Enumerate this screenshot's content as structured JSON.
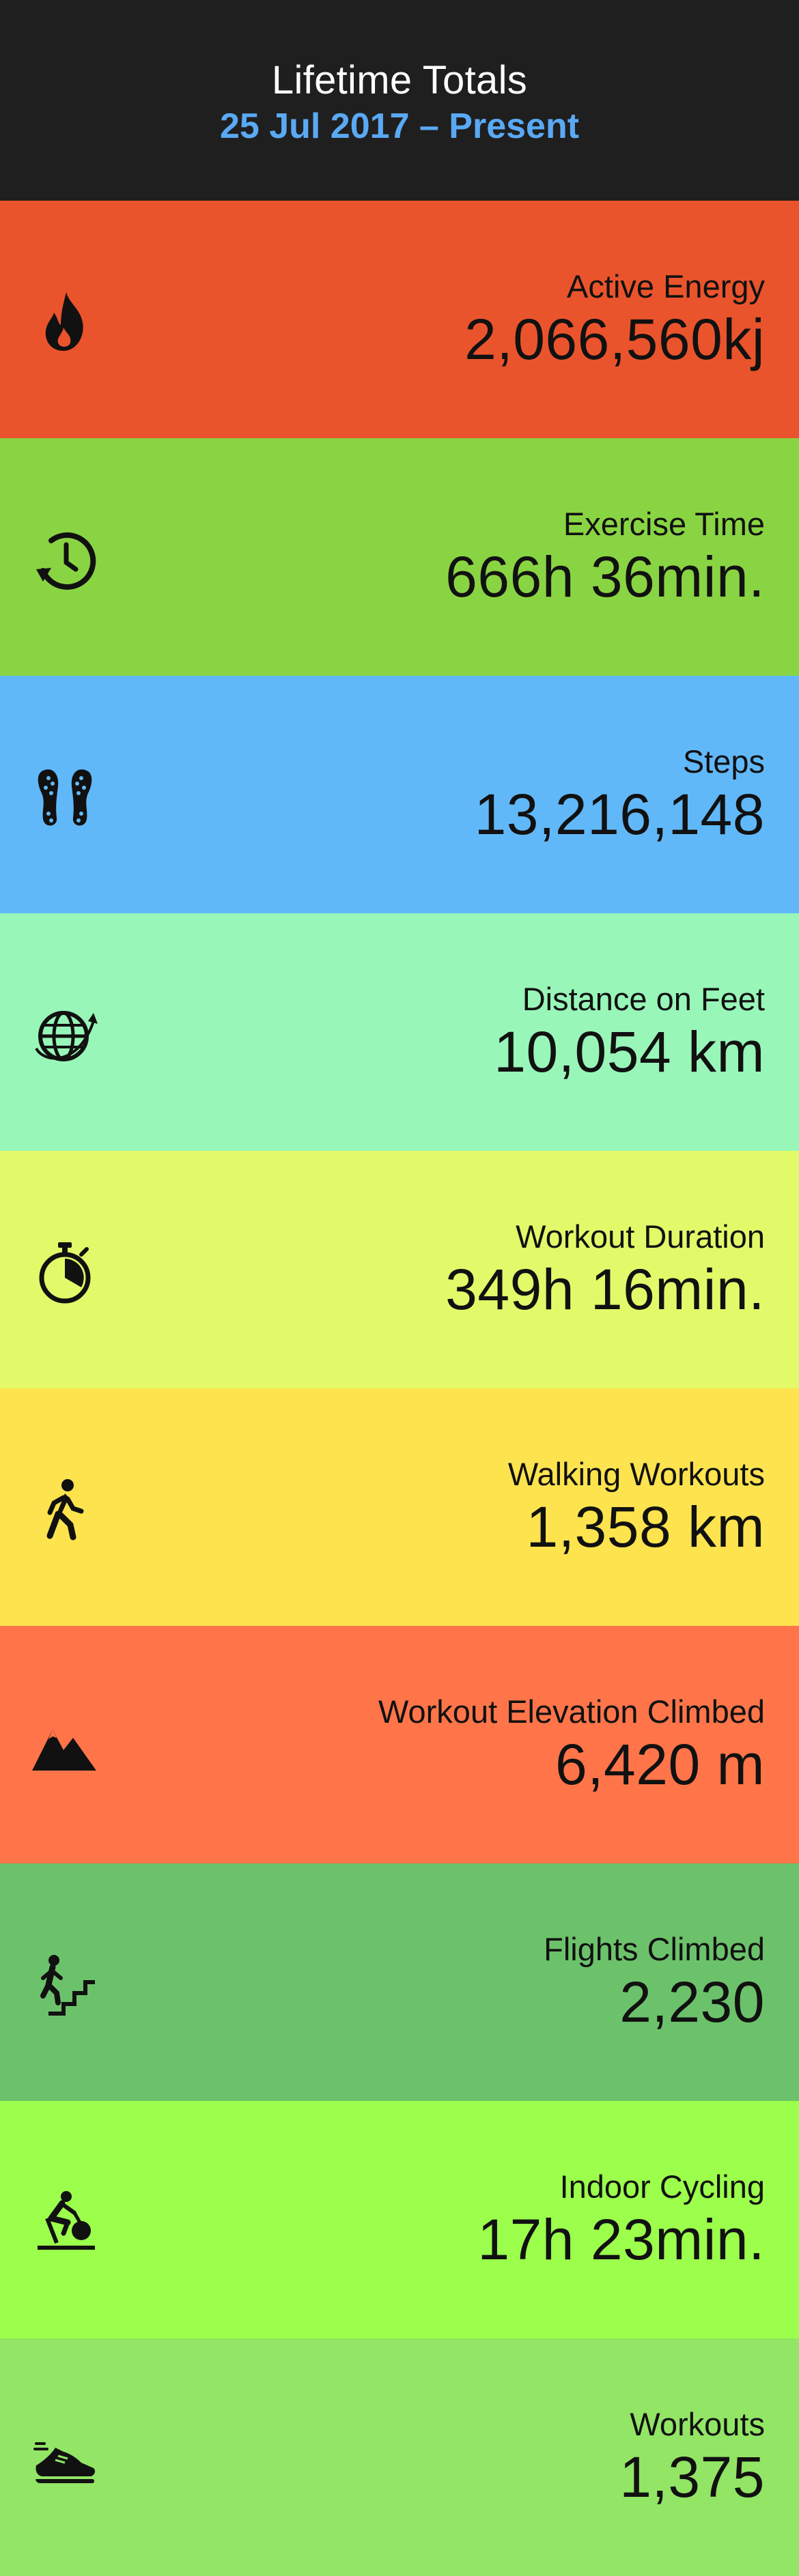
{
  "header": {
    "title": "Lifetime Totals",
    "subtitle": "25 Jul 2017 – Present",
    "subtitle_color": "#5aa9f4"
  },
  "rows": [
    {
      "label": "Active Energy",
      "value": "2,066,560kj",
      "color": "#ea542c",
      "icon": "flame-icon"
    },
    {
      "label": "Exercise Time",
      "value": "666h 36min.",
      "color": "#89d443",
      "icon": "clock-arrow-icon"
    },
    {
      "label": "Steps",
      "value": "13,216,148",
      "color": "#61b8f8",
      "icon": "footprints-icon"
    },
    {
      "label": "Distance on Feet",
      "value": "10,054 km",
      "color": "#98f6b8",
      "icon": "globe-icon"
    },
    {
      "label": "Workout Duration",
      "value": "349h 16min.",
      "color": "#e2fa69",
      "icon": "stopwatch-icon"
    },
    {
      "label": "Walking Workouts",
      "value": "1,358 km",
      "color": "#fde34e",
      "icon": "walker-icon"
    },
    {
      "label": "Workout Elevation Climbed",
      "value": "6,420 m",
      "color": "#ff7549",
      "icon": "mountain-icon"
    },
    {
      "label": "Flights Climbed",
      "value": "2,230",
      "color": "#6cc26b",
      "icon": "stairs-climber-icon"
    },
    {
      "label": "Indoor Cycling",
      "value": "17h 23min.",
      "color": "#9bff4c",
      "icon": "stationary-bike-icon"
    },
    {
      "label": "Workouts",
      "value": "1,375",
      "color": "#92e565",
      "icon": "running-shoe-icon"
    }
  ]
}
